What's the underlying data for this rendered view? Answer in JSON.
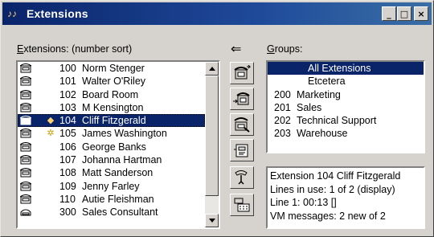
{
  "window": {
    "title": "Extensions",
    "buttons": {
      "minimize": "_",
      "maximize": "□",
      "close": "×"
    }
  },
  "extensions_label": {
    "accel": "E",
    "rest": "xtensions: (number sort)"
  },
  "groups_label": {
    "accel": "G",
    "rest": "roups:"
  },
  "arrow_indicator": "⇐",
  "extensions": [
    {
      "num": "100",
      "name": "Norm Stenger",
      "mark": ""
    },
    {
      "num": "101",
      "name": "Walter O'Riley",
      "mark": ""
    },
    {
      "num": "102",
      "name": "Board Room",
      "mark": ""
    },
    {
      "num": "103",
      "name": "M Kensington",
      "mark": ""
    },
    {
      "num": "104",
      "name": "Cliff Fitzgerald",
      "mark": "◆",
      "selected": true
    },
    {
      "num": "105",
      "name": "James Washington",
      "mark": "✲"
    },
    {
      "num": "106",
      "name": "George Banks",
      "mark": ""
    },
    {
      "num": "107",
      "name": "Johanna Hartman",
      "mark": ""
    },
    {
      "num": "108",
      "name": "Matt Sanderson",
      "mark": ""
    },
    {
      "num": "109",
      "name": "Jenny Farley",
      "mark": ""
    },
    {
      "num": "110",
      "name": "Autie Fleishman",
      "mark": ""
    },
    {
      "num": "300",
      "name": "Sales Consultant",
      "mark": "",
      "alt_icon": true
    }
  ],
  "groups": [
    {
      "num": "",
      "name": "All Extensions",
      "selected": true,
      "center": true
    },
    {
      "num": "",
      "name": "Etcetera",
      "center": true
    },
    {
      "num": "200",
      "name": "Marketing"
    },
    {
      "num": "201",
      "name": "Sales"
    },
    {
      "num": "202",
      "name": "Technical Support"
    },
    {
      "num": "203",
      "name": "Warehouse"
    }
  ],
  "info": {
    "line1": "Extension 104   Cliff Fitzgerald",
    "line2": "Lines in use:  1 of 2  (display)",
    "line3": "Line 1:  00:13  []",
    "line4": "VM messages:  2 new of 2"
  },
  "tool_buttons": [
    {
      "icon": "call-phone-icon"
    },
    {
      "icon": "transfer-phone-icon"
    },
    {
      "icon": "pickup-phone-icon"
    },
    {
      "icon": "page-intercom-icon"
    },
    {
      "icon": "hold-handset-icon"
    },
    {
      "icon": "keypad-icon"
    }
  ]
}
